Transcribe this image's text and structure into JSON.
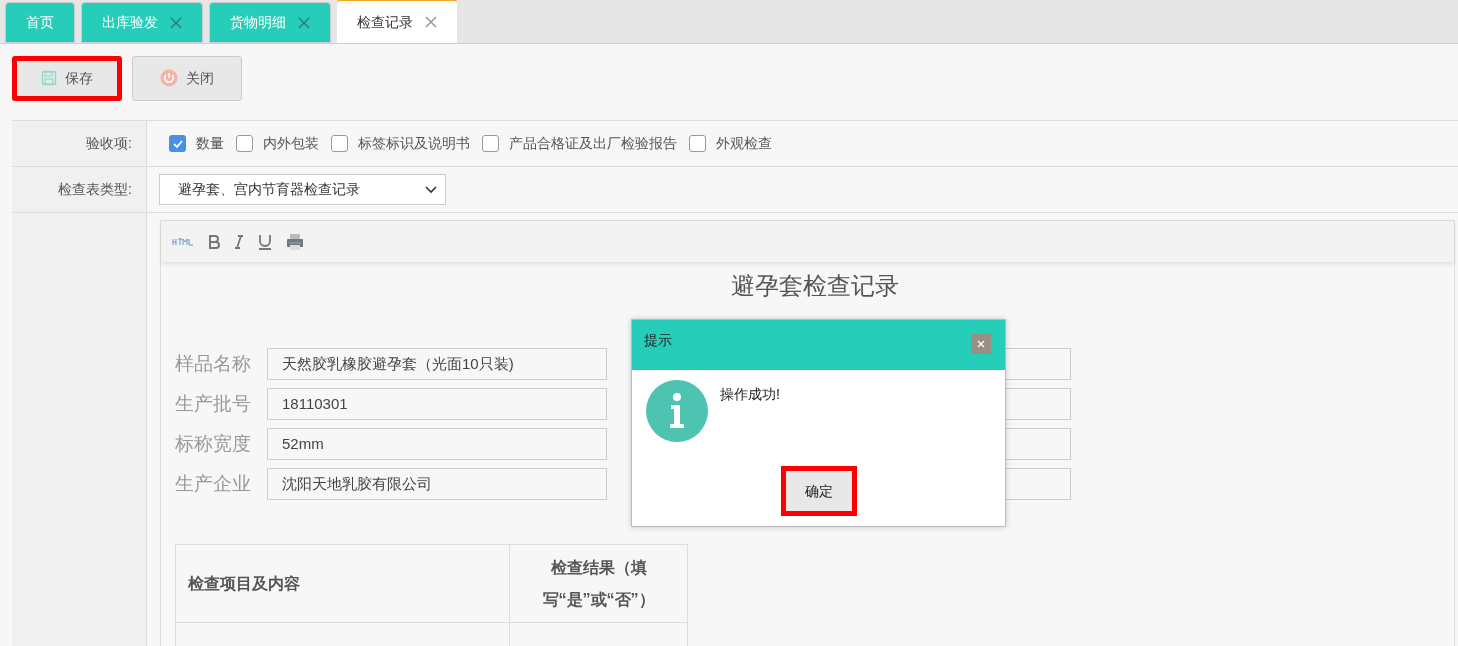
{
  "tabs": [
    {
      "label": "首页",
      "closable": false,
      "selected": false
    },
    {
      "label": "出库验发",
      "closable": true,
      "selected": false
    },
    {
      "label": "货物明细",
      "closable": true,
      "selected": false
    },
    {
      "label": "检查记录",
      "closable": true,
      "selected": true
    }
  ],
  "toolbar": [
    {
      "kind": "save",
      "label": "保存",
      "highlighted": true
    },
    {
      "kind": "close",
      "label": "关闭",
      "highlighted": false
    }
  ],
  "form": {
    "acceptance": {
      "label": "验收项:",
      "options": [
        {
          "label": "数量",
          "checked": true
        },
        {
          "label": "内外包装",
          "checked": false
        },
        {
          "label": "标签标识及说明书",
          "checked": false
        },
        {
          "label": "产品合格证及出厂检验报告",
          "checked": false
        },
        {
          "label": "外观检查",
          "checked": false
        }
      ]
    },
    "sheet_type": {
      "label": "检查表类型:",
      "value": "避孕套、宫内节育器检查记录"
    }
  },
  "editor": {
    "title": "避孕套检查记录",
    "fields": [
      {
        "label": "样品名称",
        "value": "天然胶乳橡胶避孕套（光面10只装)"
      },
      {
        "label": "生产批号",
        "value": "18110301"
      },
      {
        "label": "标称宽度",
        "value": "52mm"
      },
      {
        "label": "生产企业",
        "value": "沈阳天地乳胶有限公司"
      }
    ],
    "table": {
      "columns": [
        "检查项目及内容",
        "检查结果（填写“是”或“否”）"
      ]
    }
  },
  "dialog": {
    "title": "提示",
    "message": "操作成功!",
    "button": {
      "label": "确定",
      "highlighted": true
    }
  }
}
